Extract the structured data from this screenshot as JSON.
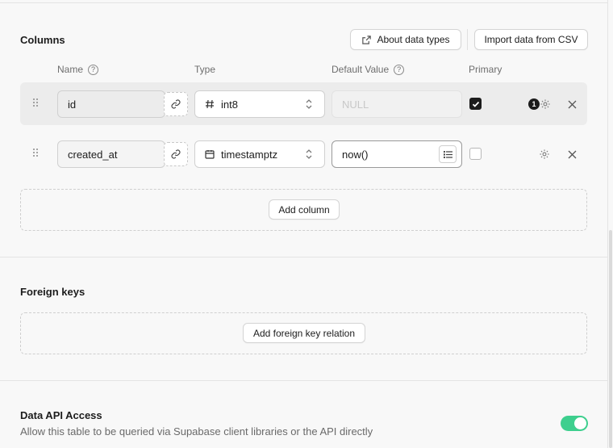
{
  "columns_section": {
    "title": "Columns",
    "about_button": "About data types",
    "import_button": "Import data from CSV",
    "headers": {
      "name": "Name",
      "type": "Type",
      "default_value": "Default Value",
      "primary": "Primary"
    },
    "rows": [
      {
        "name": "id",
        "type": "int8",
        "type_icon": "hash-icon",
        "default_placeholder": "NULL",
        "default_value": "",
        "primary": true,
        "settings_badge": "1"
      },
      {
        "name": "created_at",
        "type": "timestamptz",
        "type_icon": "calendar-icon",
        "default_placeholder": "",
        "default_value": "now()",
        "primary": false,
        "settings_badge": ""
      }
    ],
    "add_column_button": "Add column"
  },
  "foreign_keys_section": {
    "title": "Foreign keys",
    "add_button": "Add foreign key relation"
  },
  "api_access_section": {
    "title": "Data API Access",
    "description": "Allow this table to be queried via Supabase client libraries or the API directly",
    "enabled": true
  },
  "colors": {
    "toggle_on": "#3ecf8e",
    "row_highlight": "#ececec"
  }
}
